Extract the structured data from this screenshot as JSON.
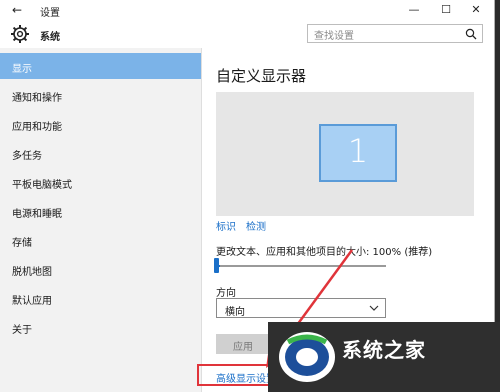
{
  "window": {
    "title": "设置",
    "back_glyph": "←",
    "minimize_glyph": "—",
    "maximize_glyph": "☐",
    "close_glyph": "✕"
  },
  "header": {
    "app_title": "系统",
    "search_placeholder": "查找设置"
  },
  "sidebar": {
    "items": [
      {
        "label": "显示",
        "active": true
      },
      {
        "label": "通知和操作"
      },
      {
        "label": "应用和功能"
      },
      {
        "label": "多任务"
      },
      {
        "label": "平板电脑模式"
      },
      {
        "label": "电源和睡眠"
      },
      {
        "label": "存储"
      },
      {
        "label": "脱机地图"
      },
      {
        "label": "默认应用"
      },
      {
        "label": "关于"
      }
    ]
  },
  "main": {
    "title": "自定义显示器",
    "monitor_number": "1",
    "identify_link": "标识",
    "detect_link": "检测",
    "scale_label": "更改文本、应用和其他项目的大小: 100% (推荐)",
    "scale_value_fraction": 0.0,
    "orientation_label": "方向",
    "orientation_value": "横向",
    "apply_label": "应用",
    "advanced_link": "高级显示设置"
  },
  "watermark": {
    "text": "系统之家"
  },
  "colors": {
    "accent": "#1a6fc8",
    "active_nav": "#7bb3e8",
    "annotation_red": "#e0343a"
  }
}
